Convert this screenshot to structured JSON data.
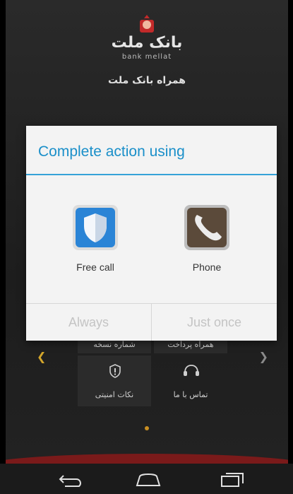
{
  "header": {
    "brand_fa": "بانک ملت",
    "brand_en": "bank mellat",
    "subtitle": "همراه بانک ملت"
  },
  "background_menu": {
    "tiles": [
      {
        "label": "شماره نسخه",
        "icon": "info-icon"
      },
      {
        "label": "همراه پرداخت",
        "icon": "payment-icon"
      },
      {
        "label": "نکات امنیتی",
        "icon": "shield-icon"
      },
      {
        "label": "تماس با ما",
        "icon": "support-icon"
      }
    ]
  },
  "dialog": {
    "title": "Complete action using",
    "options": [
      {
        "name": "Free call",
        "icon": "free-call-shield-icon"
      },
      {
        "name": "Phone",
        "icon": "phone-app-icon"
      }
    ],
    "buttons": {
      "always": "Always",
      "just_once": "Just once"
    }
  },
  "colors": {
    "accent": "#35a2d8",
    "title": "#1a8fc9",
    "gold": "#d2a52b",
    "brand_red": "#7a1a1a"
  }
}
